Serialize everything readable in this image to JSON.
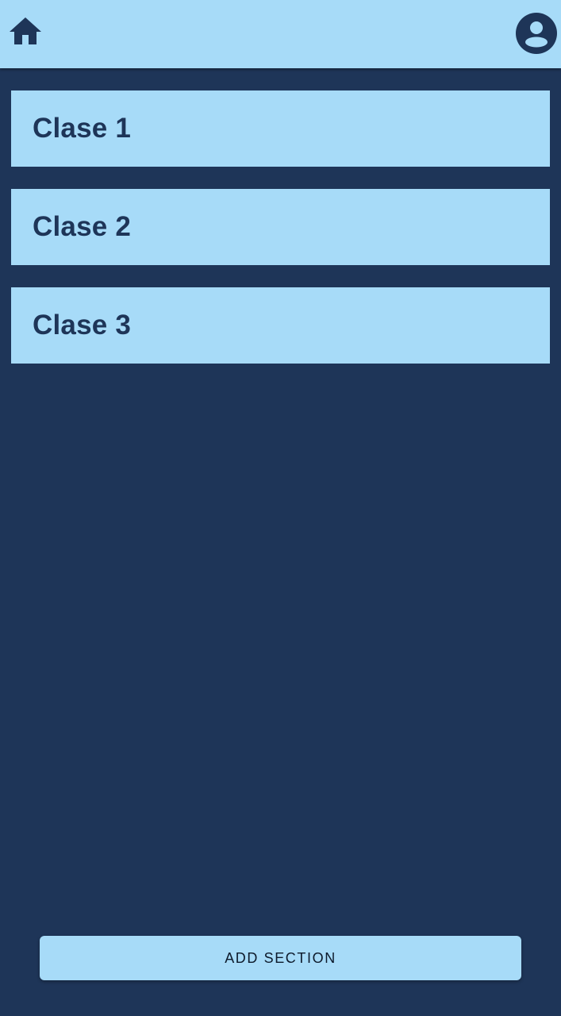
{
  "theme": {
    "background": "#1e3558",
    "surface": "#a7dbf8",
    "on_surface": "#1e3558"
  },
  "topbar": {
    "home_icon": "home-icon",
    "account_icon": "account-circle-icon"
  },
  "classes": [
    {
      "title": "Clase 1"
    },
    {
      "title": "Clase 2"
    },
    {
      "title": "Clase 3"
    }
  ],
  "actions": {
    "add_section_label": "ADD SECTION"
  }
}
